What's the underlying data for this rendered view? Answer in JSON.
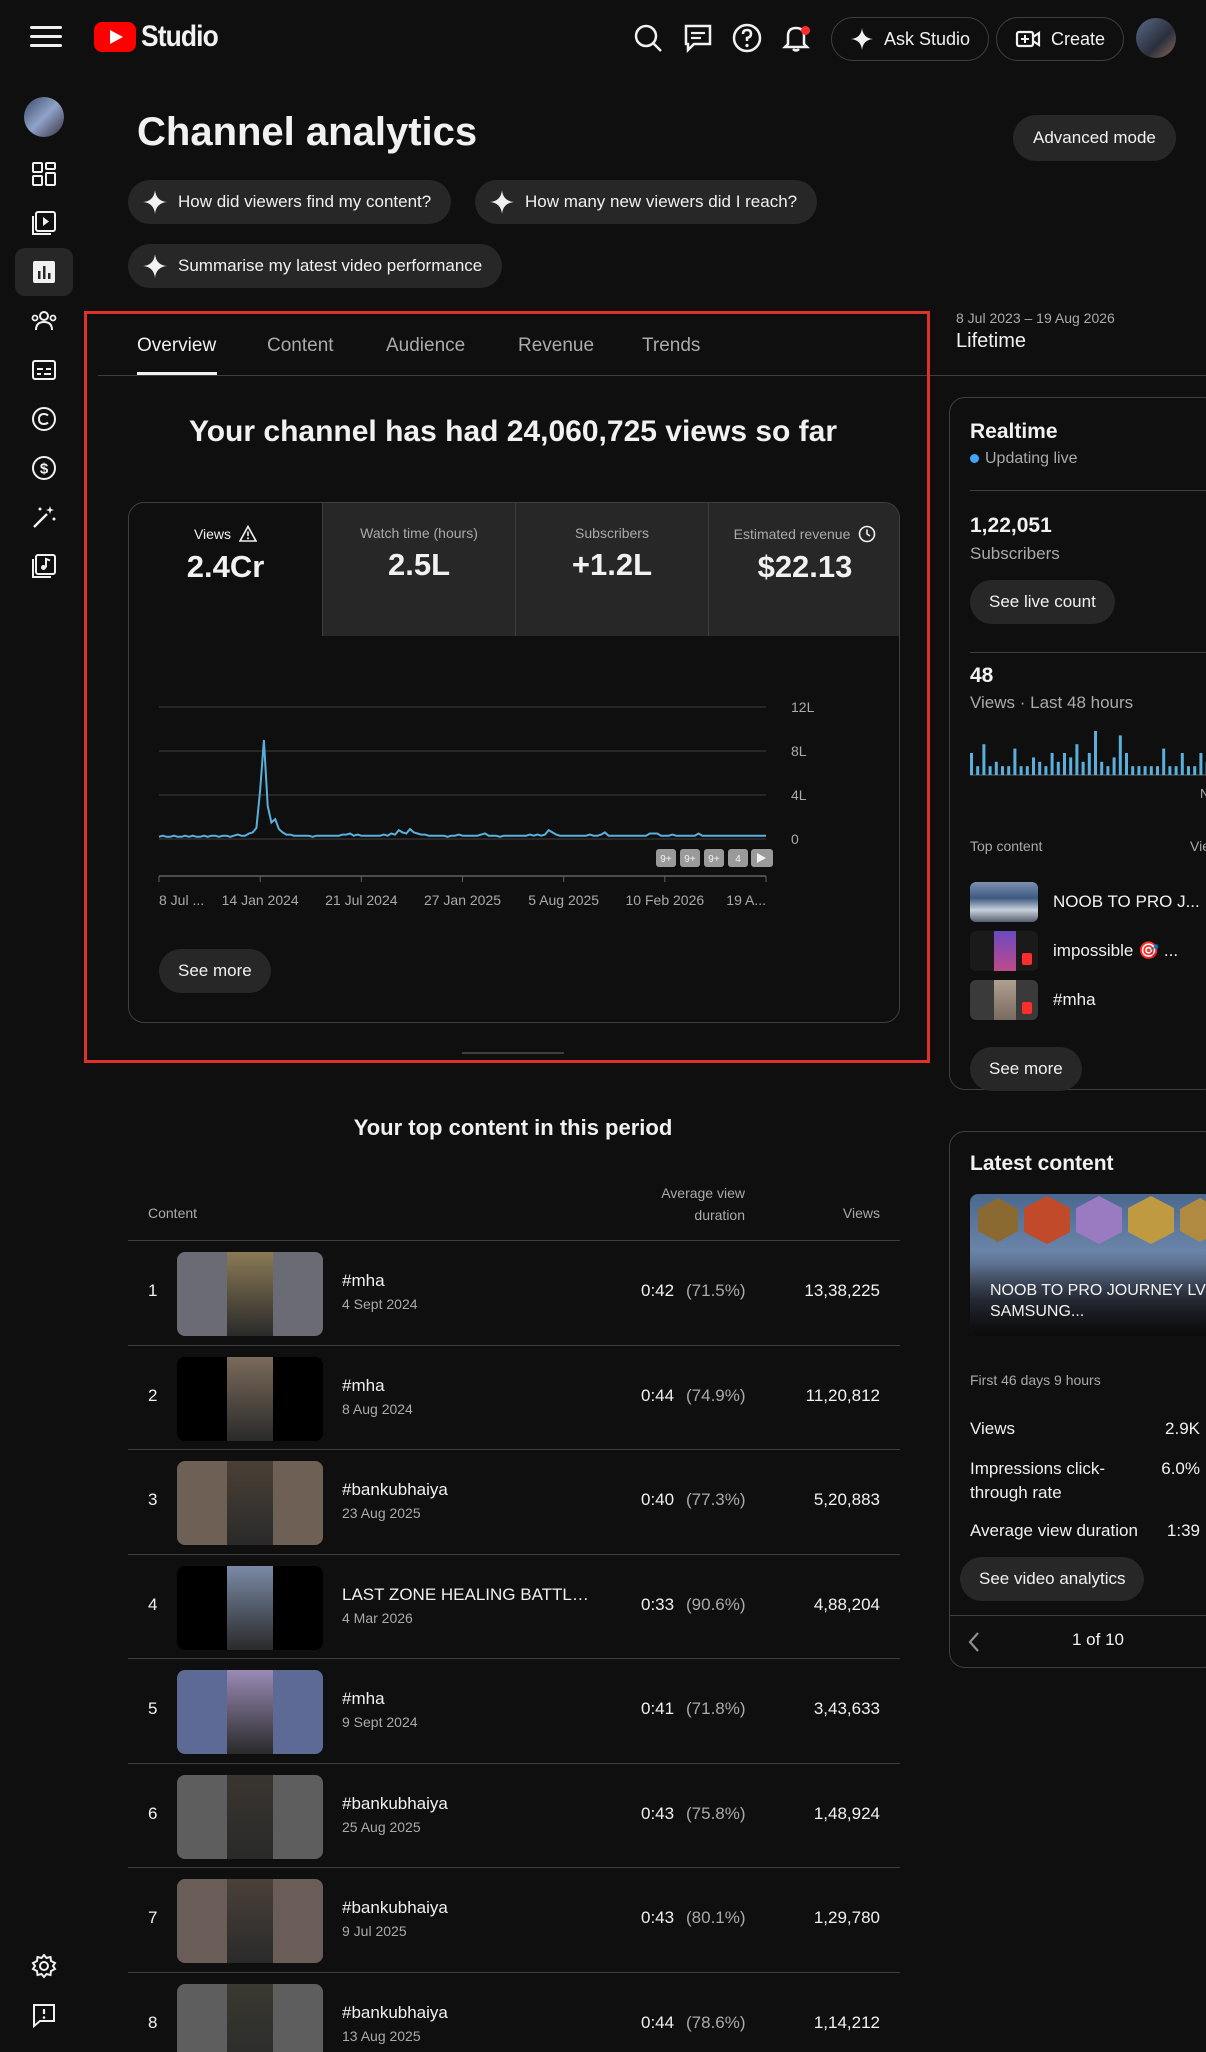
{
  "app": {
    "name": "Studio"
  },
  "header": {
    "ask_studio": "Ask Studio",
    "create": "Create"
  },
  "page": {
    "title": "Channel analytics",
    "advanced_mode": "Advanced mode",
    "prompts": [
      "How did viewers find my content?",
      "How many new viewers did I reach?",
      "Summarise my latest video performance"
    ]
  },
  "tabs": [
    "Overview",
    "Content",
    "Audience",
    "Revenue",
    "Trends"
  ],
  "active_tab": "Overview",
  "date_range": {
    "dates": "8 Jul 2023 – 19 Aug 2026",
    "label": "Lifetime"
  },
  "overview": {
    "headline": "Your channel has had 24,060,725 views so far",
    "metrics": [
      {
        "label": "Views",
        "value": "2.4Cr",
        "icon": "warning-icon",
        "active": true
      },
      {
        "label": "Watch time (hours)",
        "value": "2.5L"
      },
      {
        "label": "Subscribers",
        "value": "+1.2L"
      },
      {
        "label": "Estimated revenue",
        "value": "$22.13",
        "icon": "clock-icon"
      }
    ],
    "see_more": "See more"
  },
  "chart_data": {
    "type": "line",
    "series": [
      {
        "values": [
          0.2,
          0.3,
          0.2,
          0.2,
          0.3,
          0.2,
          0.2,
          0.3,
          0.2,
          0.3,
          0.2,
          0.2,
          0.3,
          0.2,
          0.3,
          0.3,
          0.2,
          0.3,
          0.3,
          0.2,
          0.3,
          0.4,
          0.3,
          0.3,
          0.5,
          0.6,
          1.0,
          4.5,
          9.0,
          3.0,
          1.5,
          1.8,
          0.9,
          0.6,
          0.4,
          0.4,
          0.3,
          0.3,
          0.3,
          0.3,
          0.3,
          0.2,
          0.3,
          0.3,
          0.3,
          0.3,
          0.3,
          0.3,
          0.3,
          0.4,
          0.4,
          0.5,
          0.3,
          0.4,
          0.3,
          0.3,
          0.3,
          0.3,
          0.3,
          0.3,
          0.4,
          0.3,
          0.5,
          0.4,
          0.8,
          0.6,
          0.5,
          0.9,
          0.6,
          0.5,
          0.4,
          0.4,
          0.3,
          0.3,
          0.3,
          0.3,
          0.3,
          0.2,
          0.3,
          0.3,
          0.4,
          0.3,
          0.3,
          0.3,
          0.3,
          0.3,
          0.4,
          0.5,
          0.3,
          0.3,
          0.3,
          0.2,
          0.3,
          0.3,
          0.3,
          0.3,
          0.3,
          0.3,
          0.3,
          0.4,
          0.3,
          0.4,
          0.3,
          0.4,
          0.8,
          0.6,
          0.4,
          0.3,
          0.3,
          0.3,
          0.3,
          0.3,
          0.3,
          0.3,
          0.3,
          0.4,
          0.3,
          0.3,
          0.4,
          0.6,
          0.3,
          0.3,
          0.3,
          0.3,
          0.3,
          0.3,
          0.3,
          0.3,
          0.3,
          0.3,
          0.3,
          0.5,
          0.5,
          0.5,
          0.3,
          0.3,
          0.3,
          0.4,
          0.3,
          0.3,
          0.3,
          0.3,
          0.3,
          0.3,
          0.5,
          0.3,
          0.3,
          0.3,
          0.3,
          0.3,
          0.3,
          0.3,
          0.3,
          0.3,
          0.3,
          0.3,
          0.3,
          0.3,
          0.3,
          0.3,
          0.3,
          0.3,
          0.3
        ]
      }
    ],
    "yticks": [
      "12L",
      "8L",
      "4L",
      "0"
    ],
    "ylim": [
      0,
      12
    ],
    "xticks": [
      "8 Jul ...",
      "14 Jan 2024",
      "21 Jul 2024",
      "27 Jan 2025",
      "5 Aug 2025",
      "10 Feb 2026",
      "19 A..."
    ],
    "markers": [
      "9+",
      "9+",
      "9+",
      "4"
    ]
  },
  "top_content": {
    "title": "Your top content in this period",
    "columns": {
      "content": "Content",
      "avd": "Average view duration",
      "views": "Views"
    },
    "rows": [
      {
        "rank": "1",
        "title": "#mha",
        "date": "4 Sept 2024",
        "avd": "0:42",
        "pct": "(71.5%)",
        "views": "13,38,225",
        "bg": "#6b6b75",
        "fg": "#8a7a55"
      },
      {
        "rank": "2",
        "title": "#mha",
        "date": "8 Aug 2024",
        "avd": "0:44",
        "pct": "(74.9%)",
        "views": "11,20,812",
        "bg": "#000000",
        "fg": "#7a6a5a"
      },
      {
        "rank": "3",
        "title": "#bankubhaiya",
        "date": "23 Aug 2025",
        "avd": "0:40",
        "pct": "(77.3%)",
        "views": "5,20,883",
        "bg": "#6e6055",
        "fg": "#4a4035"
      },
      {
        "rank": "4",
        "title": "LAST ZONE HEALING BATTLE ...",
        "date": "4 Mar 2026",
        "avd": "0:33",
        "pct": "(90.6%)",
        "views": "4,88,204",
        "bg": "#000000",
        "fg": "#7a8aa5"
      },
      {
        "rank": "5",
        "title": "#mha",
        "date": "9 Sept 2024",
        "avd": "0:41",
        "pct": "(71.8%)",
        "views": "3,43,633",
        "bg": "#5d6a95",
        "fg": "#9a8ab5"
      },
      {
        "rank": "6",
        "title": "#bankubhaiya",
        "date": "25 Aug 2025",
        "avd": "0:43",
        "pct": "(75.8%)",
        "views": "1,48,924",
        "bg": "#5e5e5e",
        "fg": "#3a3530"
      },
      {
        "rank": "7",
        "title": "#bankubhaiya",
        "date": "9 Jul 2025",
        "avd": "0:43",
        "pct": "(80.1%)",
        "views": "1,29,780",
        "bg": "#6a5d58",
        "fg": "#4a4038"
      },
      {
        "rank": "8",
        "title": "#bankubhaiya",
        "date": "13 Aug 2025",
        "avd": "0:44",
        "pct": "(78.6%)",
        "views": "1,14,212",
        "bg": "#5e5e5e",
        "fg": "#3a3a30"
      }
    ]
  },
  "realtime": {
    "title": "Realtime",
    "status": "Updating live",
    "subscribers_value": "1,22,051",
    "subscribers_label": "Subscribers",
    "live_count_btn": "See live count",
    "views_value": "48",
    "views_label": "Views · Last 48 hours",
    "axis_label": "N",
    "bars": [
      0.5,
      0.2,
      0.7,
      0.2,
      0.3,
      0.2,
      0.2,
      0.6,
      0.2,
      0.2,
      0.4,
      0.3,
      0.2,
      0.5,
      0.3,
      0.5,
      0.4,
      0.7,
      0.3,
      0.5,
      1.0,
      0.3,
      0.2,
      0.4,
      0.9,
      0.5,
      0.2,
      0.2,
      0.2,
      0.2,
      0.2,
      0.6,
      0.2,
      0.2,
      0.5,
      0.2,
      0.2,
      0.5,
      0.3,
      0.4
    ],
    "top_content_label": "Top content",
    "top_content_col": "Vie",
    "top_content": [
      "NOOB TO PRO J...",
      "impossible 🎯 ...",
      "#mha"
    ],
    "see_more": "See more"
  },
  "latest": {
    "title": "Latest content",
    "video_title": "NOOB TO PRO JOURNEY LVL SAMSUNG...",
    "period": "First 46 days 9 hours",
    "stats": [
      {
        "label": "Views",
        "value": "2.9K"
      },
      {
        "label": "Impressions click-through rate",
        "value": "6.0%"
      },
      {
        "label": "Average view duration",
        "value": "1:39"
      }
    ],
    "analytics_btn": "See video analytics",
    "pager": "1 of 10"
  }
}
